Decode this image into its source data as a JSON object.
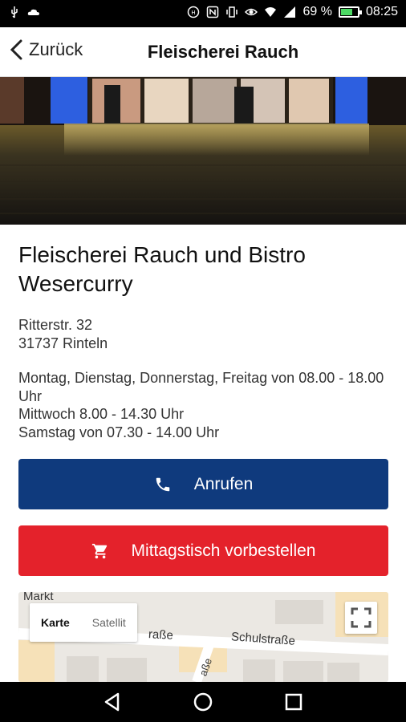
{
  "status_bar": {
    "battery_text": "69 %",
    "time": "08:25",
    "battery_level": 0.69,
    "icons_left": [
      "usb-icon",
      "cloud-icon"
    ],
    "icons_right": [
      "alarm-icon",
      "nfc-icon",
      "vibrate-icon",
      "eye-icon",
      "wifi-icon",
      "signal-icon",
      "battery-icon"
    ]
  },
  "app_bar": {
    "back_label": "Zurück",
    "title": "Fleischerei Rauch"
  },
  "shop": {
    "name": "Fleischerei Rauch und Bistro Wesercurry",
    "address_line1": "Ritterstr. 32",
    "address_line2": "31737 Rinteln",
    "hours": [
      "Montag, Dienstag, Donnerstag, Freitag von 08.00 - 18.00 Uhr",
      "Mittwoch 8.00 - 14.30 Uhr",
      "Samstag von 07.30 - 14.00 Uhr"
    ]
  },
  "buttons": {
    "call_label": "Anrufen",
    "order_label": "Mittagstisch vorbestellen"
  },
  "map": {
    "toggle_map": "Karte",
    "toggle_satellite": "Satellit",
    "label_markt": "Markt",
    "label_strasse": "raße",
    "label_schulstrasse": "Schulstraße",
    "label_vertical": "aße"
  },
  "colors": {
    "call_button": "#0f3a7d",
    "order_button": "#e4222b"
  }
}
